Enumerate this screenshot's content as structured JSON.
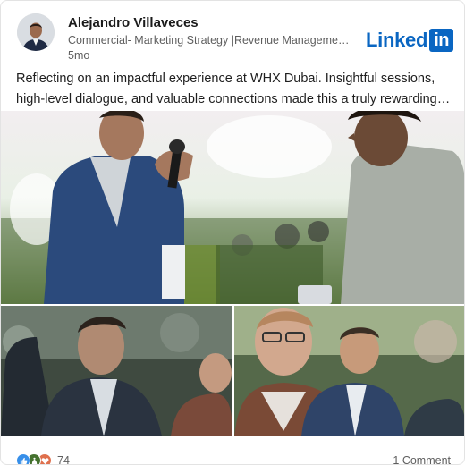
{
  "post": {
    "author": {
      "name": "Alejandro Villaveces",
      "headline": "Commercial- Marketing Strategy |Revenue Management |Business Development",
      "time": "5mo",
      "avatar_icon": "profile-photo"
    },
    "brand": {
      "logo_word": "Linked",
      "logo_in": "in",
      "color": "#0a66c2"
    },
    "text_lines": [
      "Reflecting on an impactful experience at WHX Dubai. Insightful sessions,",
      "high-level dialogue, and valuable connections made this a truly rewarding…"
    ],
    "photos": [
      {
        "subject": "two men in conversation, one holding a microphone"
      },
      {
        "subject": "man in dark suit looking up in audience"
      },
      {
        "subject": "man with glasses and lanyard in audience"
      }
    ],
    "reactions": {
      "icons": [
        "like-icon",
        "celebrate-icon",
        "love-icon"
      ],
      "count": "74"
    },
    "comments_label": "1 Comment"
  }
}
